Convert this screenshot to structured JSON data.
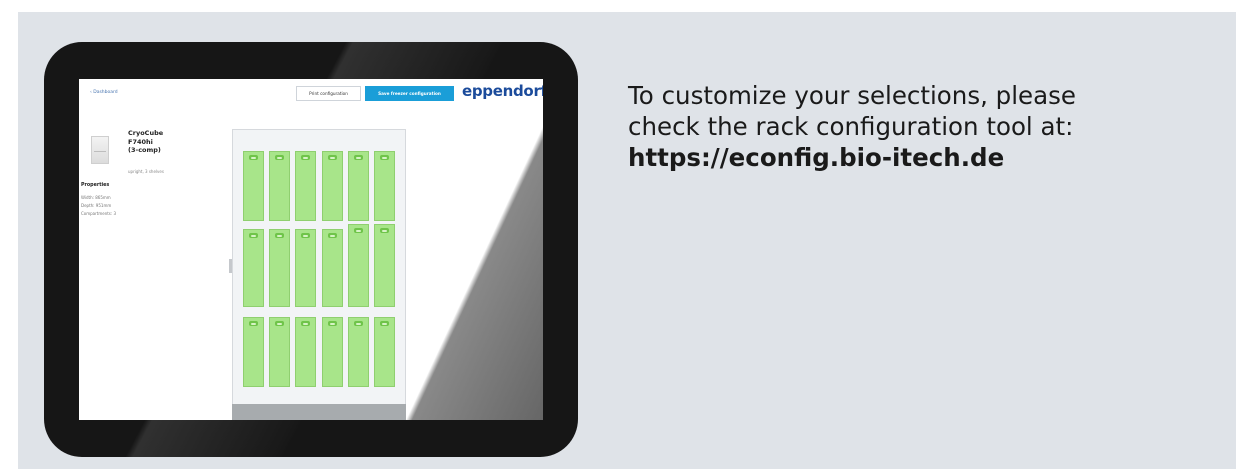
{
  "message": {
    "line1": "To customize your selections, please",
    "line2": "check the rack configuration tool at:",
    "url": "https://econfig.bio-itech.de"
  },
  "tablet_screen": {
    "back_link": "‹ Dashboard",
    "print_button": "Print configuration",
    "save_button": "Save freezer configuration",
    "logo": "eppendorf",
    "model": {
      "name_line1": "CryoCube",
      "name_line2": "F740hi",
      "name_line3": "(3-comp)",
      "subtitle": "upright, 3 shelves"
    },
    "properties": {
      "title": "Properties",
      "items": [
        "Width: 865mm",
        "Depth: 951mm",
        "Compartments: 3"
      ]
    },
    "rack": {
      "shelves": 3,
      "drawers_per_shelf": 6
    }
  },
  "colors": {
    "panel_bg": "#dfe3e8",
    "drawer_green": "#a8e58a",
    "save_button_blue": "#1a9ed8",
    "logo_blue": "#1b4b9b"
  },
  "icons": [
    "freezer-icon"
  ]
}
